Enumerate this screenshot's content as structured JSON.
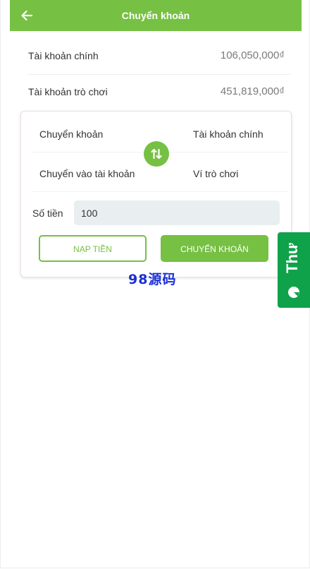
{
  "header": {
    "title": "Chuyển khoản",
    "back_icon": "arrow-left-icon"
  },
  "balances": [
    {
      "label": "Tài khoản chính",
      "amount": "106,050,000₫"
    },
    {
      "label": "Tài khoản trò chơi",
      "amount": "451,819,000₫"
    }
  ],
  "transfer": {
    "from_label": "Chuyển khoản",
    "from_value": "Tài khoản chính",
    "to_label": "Chuyển vào tài khoản",
    "to_value": "Ví trò chơi",
    "swap_icon": "swap-vertical-icon",
    "amount_label": "Số tiền",
    "amount_value": "100"
  },
  "buttons": {
    "deposit": "NẠP TIỀN",
    "transfer": "CHUYỂN KHOẢN"
  },
  "watermark": "98源码",
  "side_tab": {
    "label": "Thư",
    "icon": "chat-bubble-icon"
  },
  "colors": {
    "primary": "#76c043",
    "side_tab": "#0fa24a",
    "watermark": "#1b2fd6"
  }
}
